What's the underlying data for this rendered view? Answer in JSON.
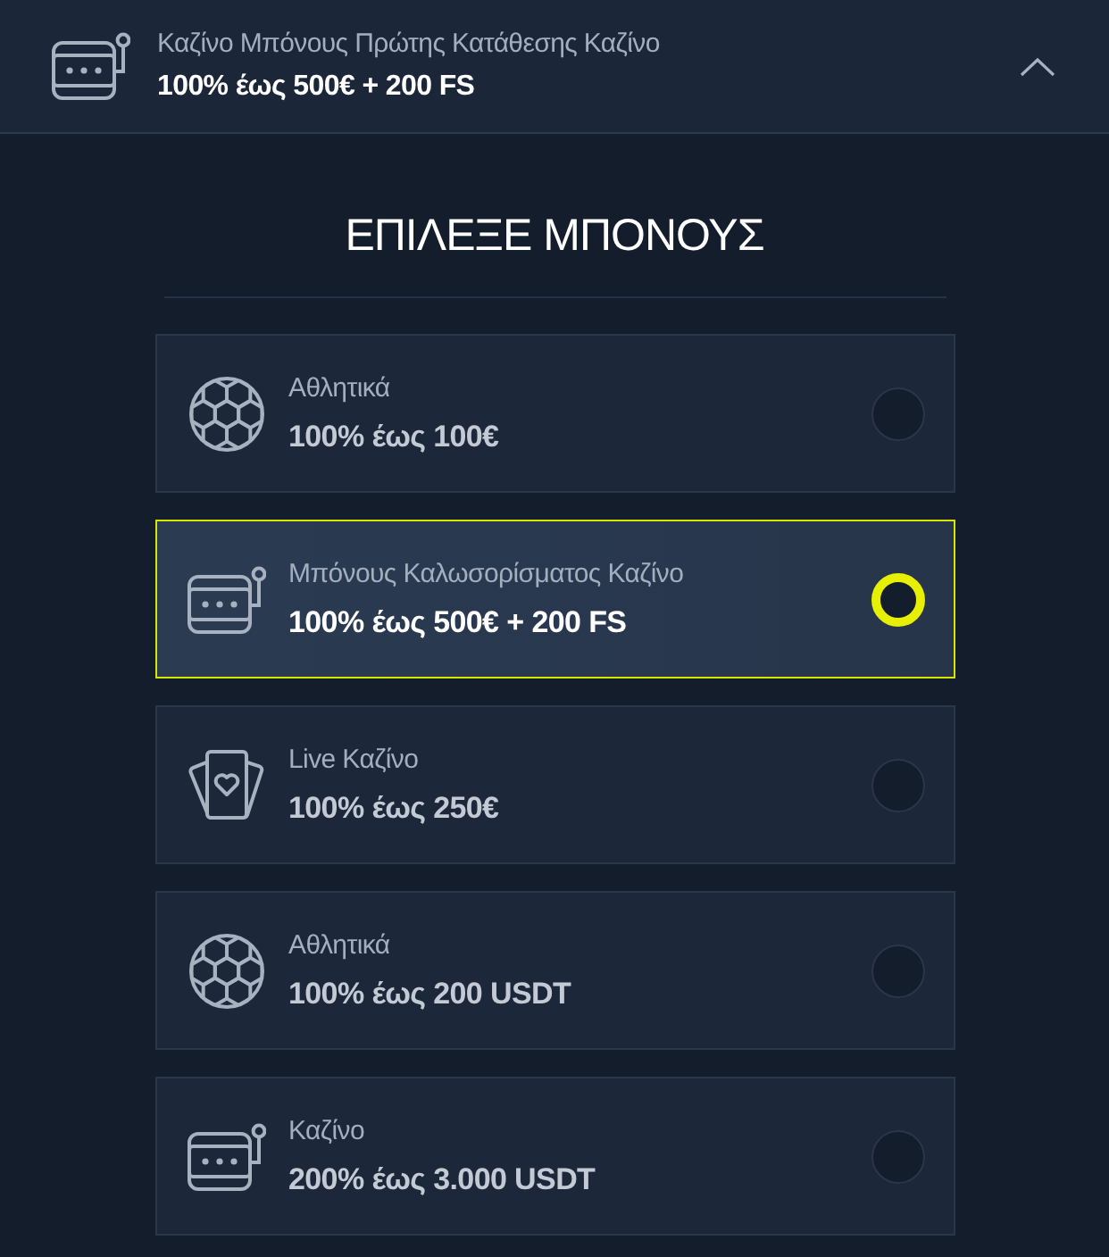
{
  "header": {
    "kind": "casino",
    "title": "Καζίνο Μπόνους Πρώτης Κατάθεσης Καζίνο",
    "amount": "100% έως 500€ + 200 FS",
    "expanded": true
  },
  "heading": "ΕΠΙΛΕΞΕ ΜΠΟΝΟΥΣ",
  "options": [
    {
      "kind": "sports",
      "label": "Αθλητικά",
      "amount": "100% έως 100€",
      "selected": false
    },
    {
      "kind": "casino",
      "label": "Μπόνους Καλωσορίσματος Καζίνο",
      "amount": "100% έως 500€ + 200 FS",
      "selected": true
    },
    {
      "kind": "live_casino",
      "label": "Live Καζίνο",
      "amount": "100% έως 250€",
      "selected": false
    },
    {
      "kind": "sports",
      "label": "Αθλητικά",
      "amount": "100% έως 200 USDT",
      "selected": false
    },
    {
      "kind": "casino",
      "label": "Καζίνο",
      "amount": "200% έως 3.000 USDT",
      "selected": false
    }
  ]
}
